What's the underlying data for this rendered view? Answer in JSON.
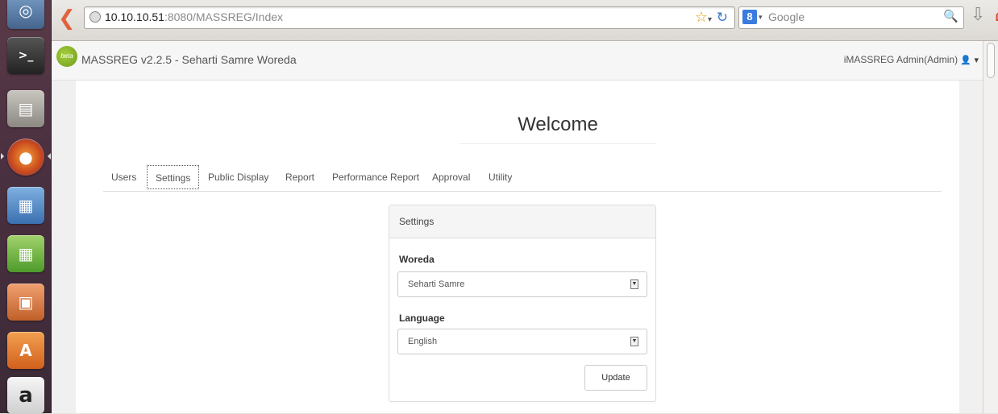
{
  "browser": {
    "url_host": "10.10.10.51",
    "url_rest": ":8080/MASSREG/Index",
    "search_placeholder": "Google"
  },
  "navbar": {
    "badge": "beta",
    "brand": "MASSREG v2.2.5 - Seharti Samre Woreda",
    "user": "iMASSREG Admin(Admin)"
  },
  "page": {
    "title": "Welcome"
  },
  "tabs": [
    {
      "label": "Users"
    },
    {
      "label": "Settings",
      "active": true
    },
    {
      "label": "Public Display"
    },
    {
      "label": "Report"
    },
    {
      "label": "Performance Report"
    },
    {
      "label": "Approval"
    },
    {
      "label": "Utility"
    }
  ],
  "settings_panel": {
    "heading": "Settings",
    "woreda_label": "Woreda",
    "woreda_value": "Seharti Samre",
    "language_label": "Language",
    "language_value": "English",
    "update_label": "Update"
  },
  "launcher": {
    "icons": [
      "ubuntu-dash-icon",
      "terminal-icon",
      "files-icon",
      "firefox-icon",
      "writer-icon",
      "calc-icon",
      "impress-icon",
      "software-center-icon",
      "amazon-icon",
      "settings-icon"
    ],
    "amazon_glyph": "a",
    "terminal_glyph": ">_",
    "software_glyph": "A"
  }
}
